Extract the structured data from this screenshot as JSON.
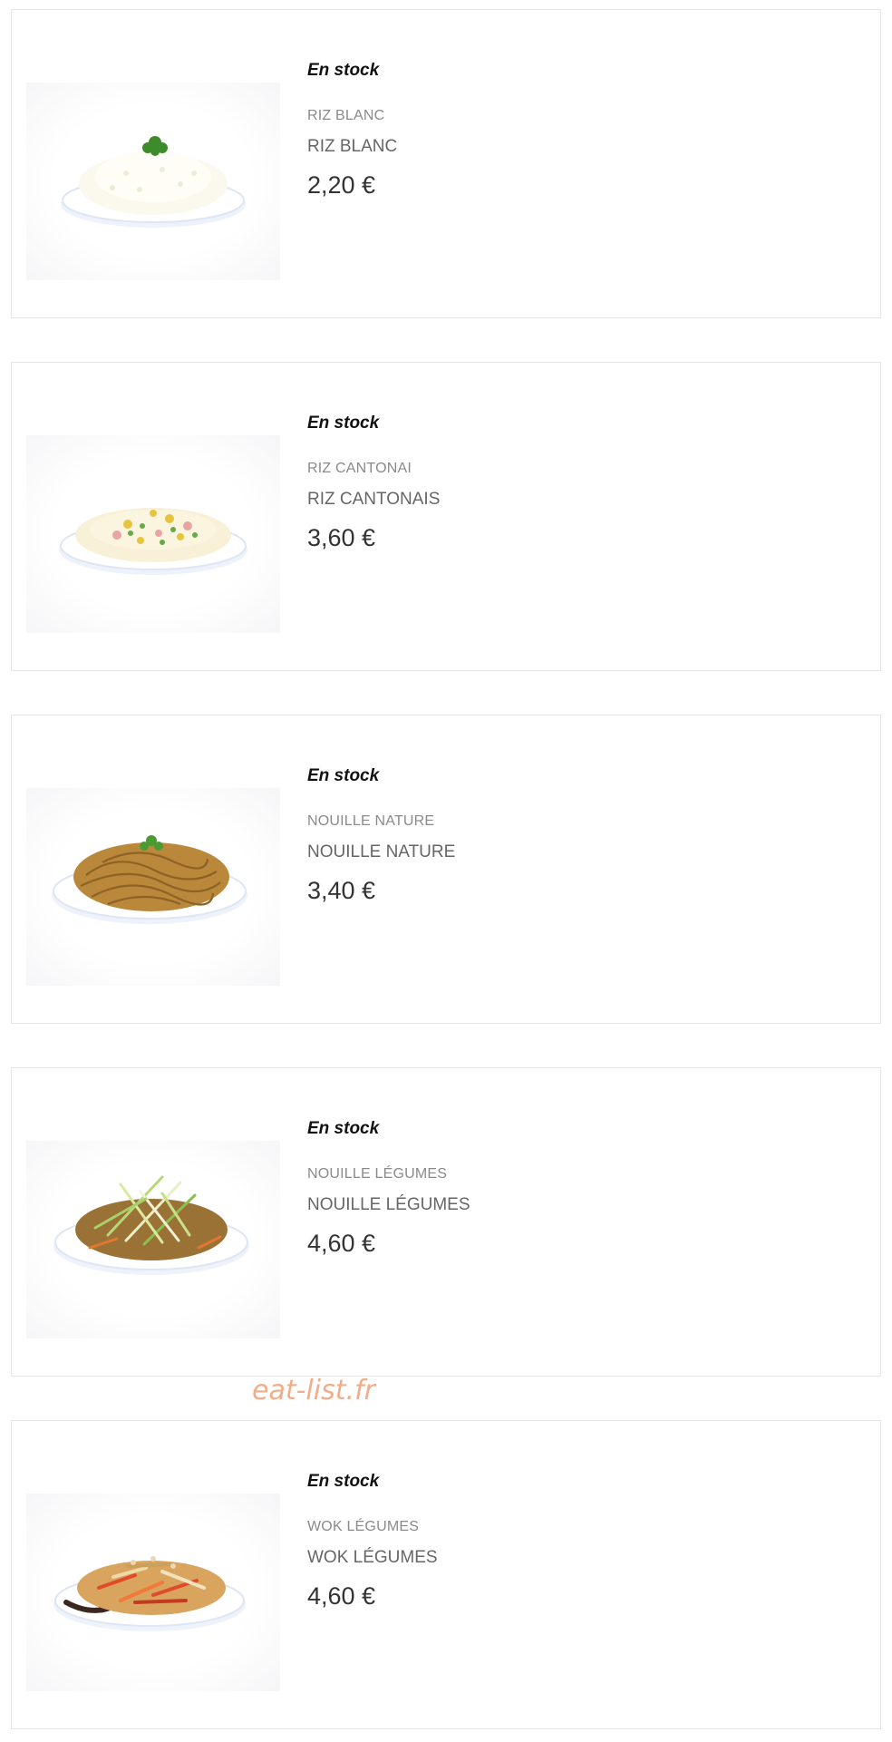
{
  "products": [
    {
      "stock": "En stock",
      "ref": "RIZ BLANC",
      "name": "RIZ BLANC",
      "price": "2,20 €",
      "image": "white-rice-dish"
    },
    {
      "stock": "En stock",
      "ref": "RIZ CANTONAI",
      "name": "RIZ CANTONAIS",
      "price": "3,60 €",
      "image": "cantonese-rice-dish"
    },
    {
      "stock": "En stock",
      "ref": "NOUILLE NATURE",
      "name": "NOUILLE NATURE",
      "price": "3,40 €",
      "image": "plain-noodles-dish"
    },
    {
      "stock": "En stock",
      "ref": "NOUILLE LÉGUMES",
      "name": "NOUILLE LÉGUMES",
      "price": "4,60 €",
      "image": "vegetable-noodles-dish"
    },
    {
      "stock": "En stock",
      "ref": "WOK LÉGUMES",
      "name": "WOK LÉGUMES",
      "price": "4,60 €",
      "image": "wok-vegetables-dish"
    }
  ],
  "watermark": "eat-list.fr"
}
